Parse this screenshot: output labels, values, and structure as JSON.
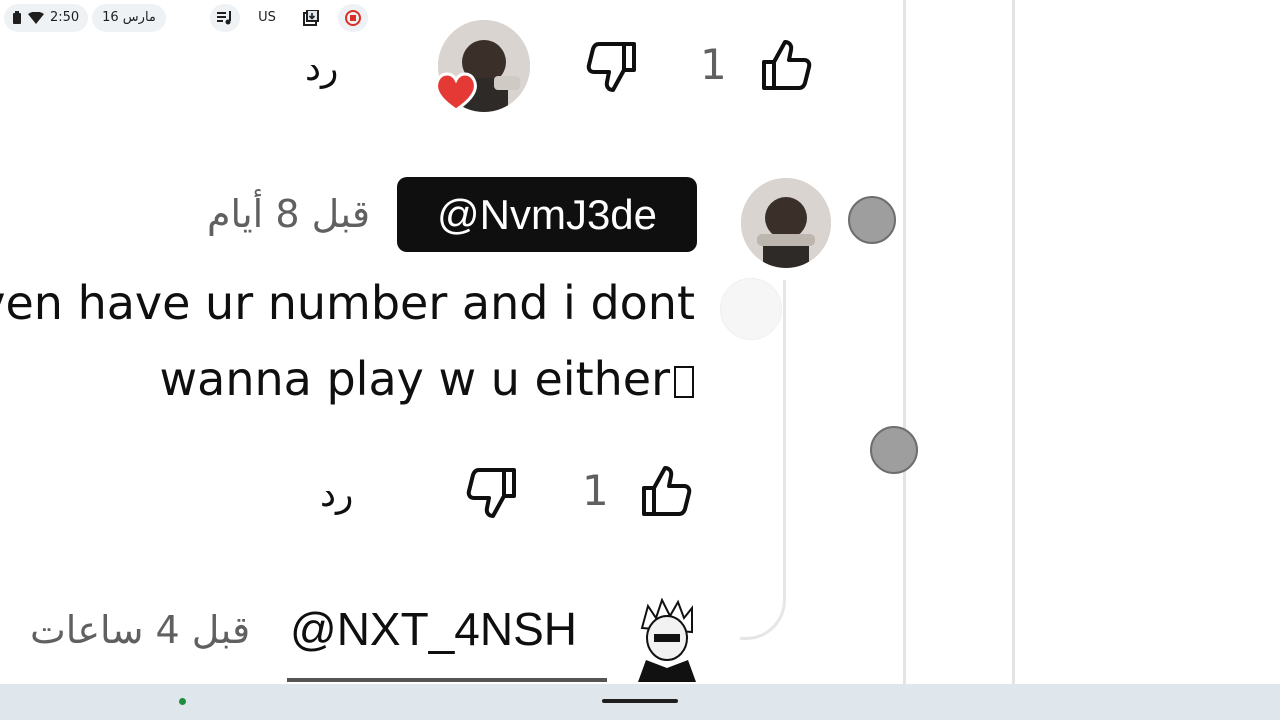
{
  "comment_top": {
    "like_count": "1",
    "reply_label": "رد"
  },
  "comment_main": {
    "mention": "@NvmJ3de",
    "time": "قبل 8 أيام",
    "text_line1": "ven have ur number and i dont",
    "text_line2": "wanna play w u either",
    "like_count": "1",
    "reply_label": "رد"
  },
  "comment_next": {
    "username": "@NXT_4NSH",
    "time": "قبل 4 ساعات"
  },
  "shelf": {
    "clock": "2:50",
    "date": "16 مارس",
    "ime": "US"
  },
  "colors": {
    "chip_bg": "#0f0f0f",
    "heart": "#e53935",
    "shelf_bg": "#dfe7ec",
    "record": "#d93025",
    "status_dot": "#1e8e3e"
  }
}
